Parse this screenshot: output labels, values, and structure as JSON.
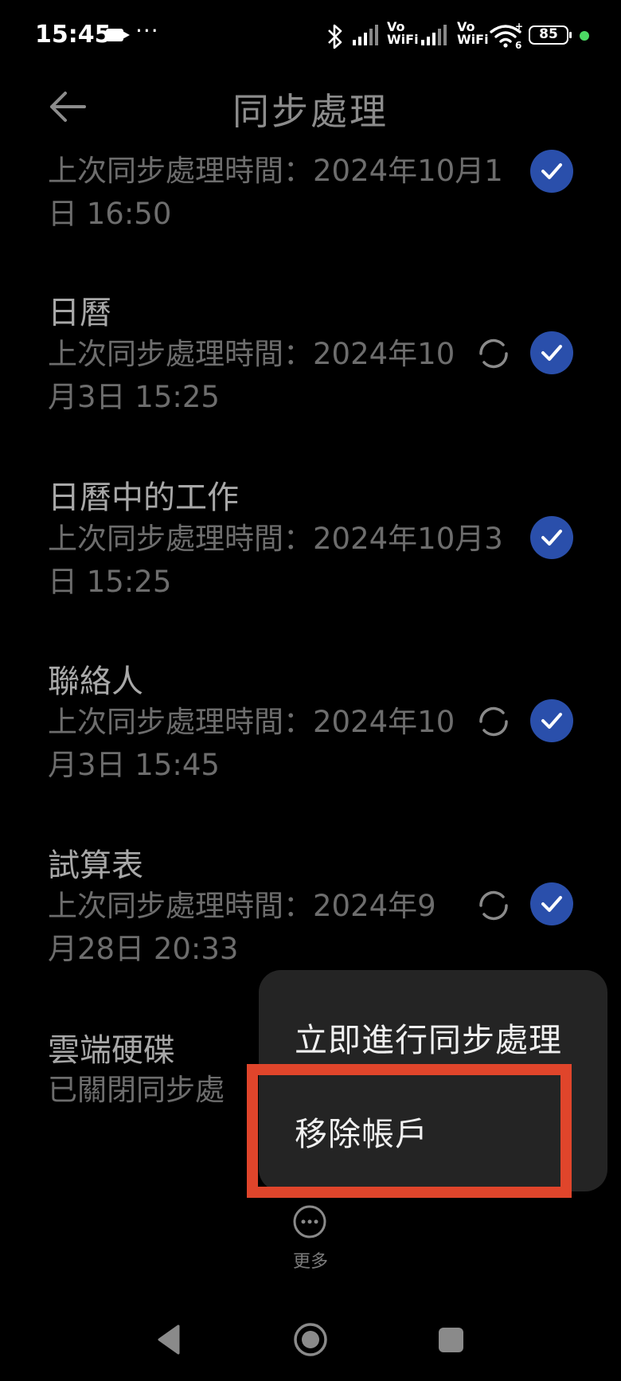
{
  "status_bar": {
    "time": "15:45",
    "more_dots": "···",
    "vo_wifi_1": "Vo\nWiFi",
    "vo_wifi_1_top": "Vo",
    "vo_wifi_1_bottom": "WiFi",
    "vo_wifi_2_top": "Vo",
    "vo_wifi_2_bottom": "WiFi",
    "battery": "85",
    "indicator_color": "#4cd964"
  },
  "header": {
    "title": "同步處理",
    "back_icon": "arrow-left-icon"
  },
  "sync_items": [
    {
      "title": "",
      "subtitle": "上次同步處理時間：2024年10月1日 16:50",
      "checked": true,
      "syncing": false
    },
    {
      "title": "日曆",
      "subtitle": "上次同步處理時間：2024年10月3日 15:25",
      "checked": true,
      "syncing": true
    },
    {
      "title": "日曆中的工作",
      "subtitle": "上次同步處理時間：2024年10月3日 15:25",
      "checked": true,
      "syncing": false
    },
    {
      "title": "聯絡人",
      "subtitle": "上次同步處理時間：2024年10月3日 15:45",
      "checked": true,
      "syncing": true
    },
    {
      "title": "試算表",
      "subtitle": "上次同步處理時間：2024年9月28日 20:33",
      "checked": true,
      "syncing": true
    },
    {
      "title": "雲端硬碟",
      "subtitle": "已關閉同步處",
      "checked": false,
      "syncing": false
    }
  ],
  "popup_menu": {
    "items": [
      {
        "label": "立即進行同步處理"
      },
      {
        "label": "移除帳戶"
      }
    ],
    "highlight_color": "#e0452b"
  },
  "more": {
    "label": "更多",
    "icon": "more-horizontal-icon"
  },
  "nav_bar": {
    "back_icon": "nav-back-icon",
    "home_icon": "nav-home-icon",
    "recent_icon": "nav-recent-icon"
  },
  "colors": {
    "accent": "#2a4fab",
    "background": "#000000",
    "menu": "#242424"
  }
}
